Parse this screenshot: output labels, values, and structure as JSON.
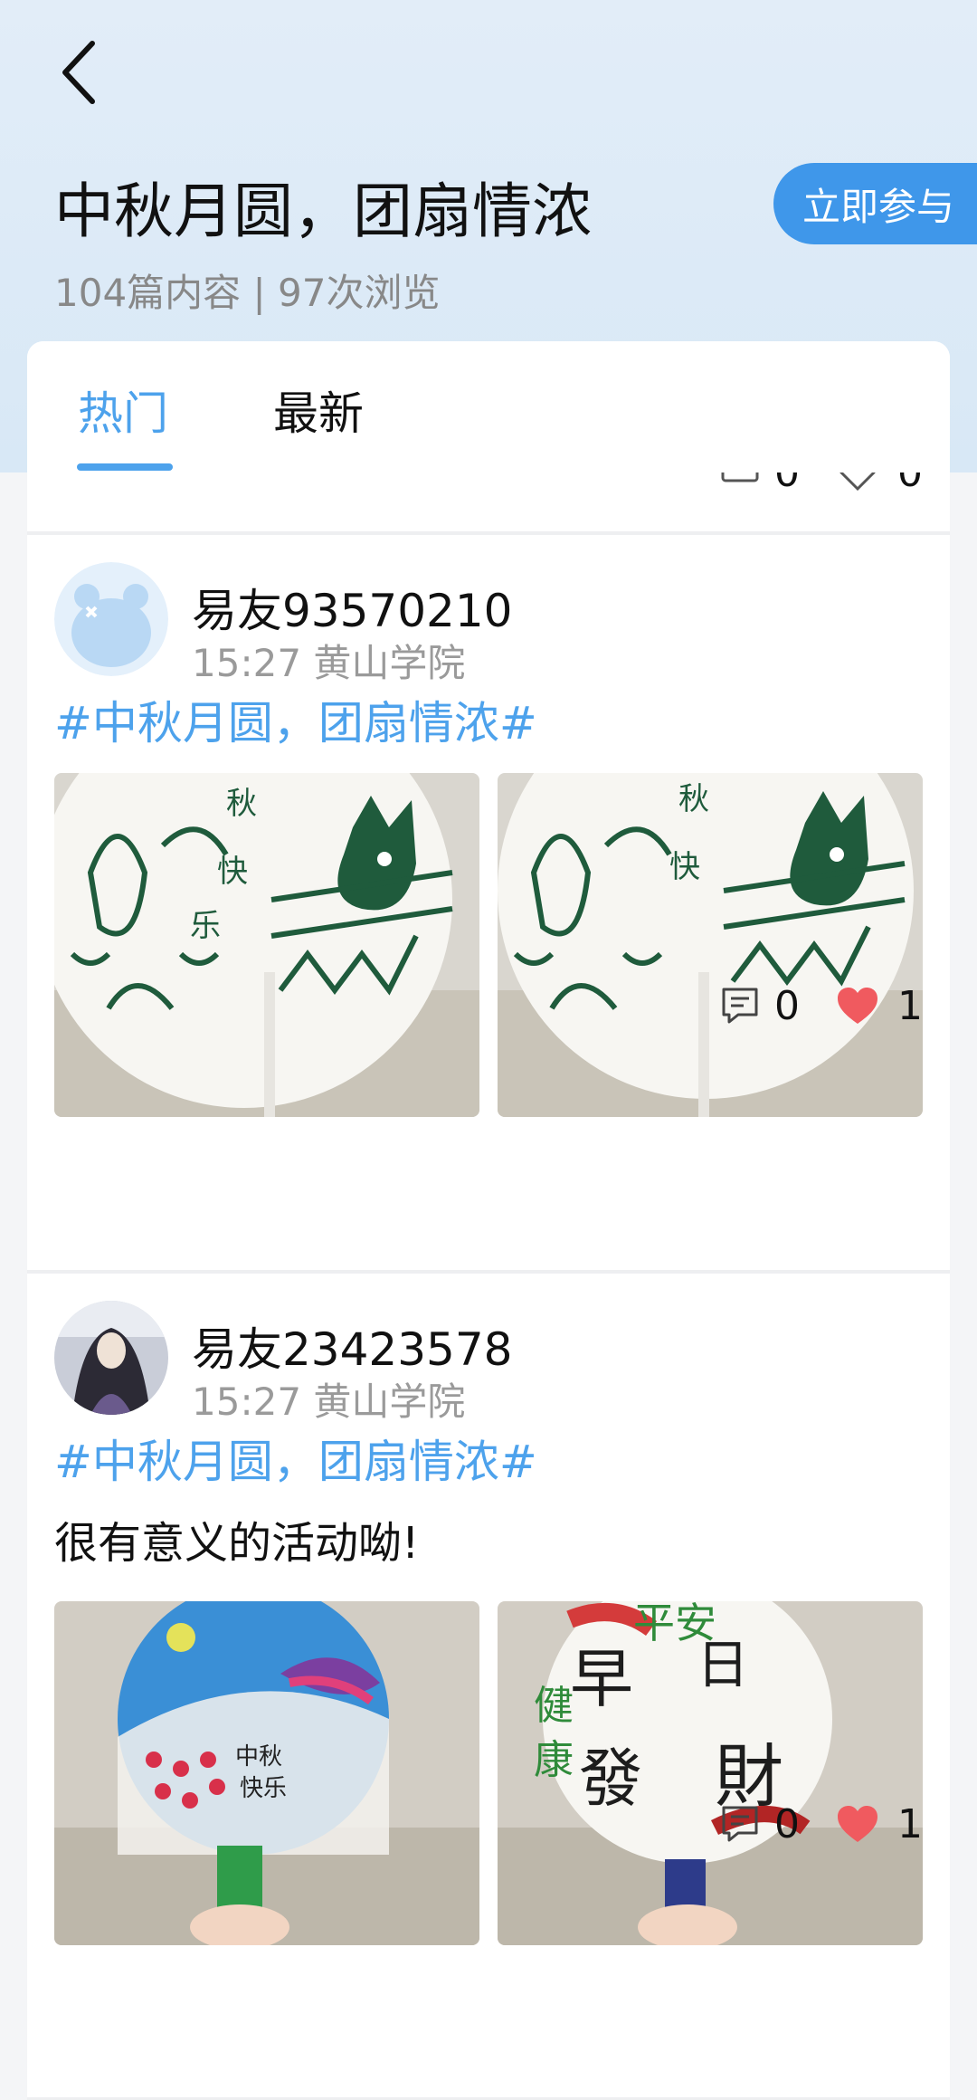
{
  "header": {
    "title": "中秋月圆，团扇情浓",
    "stats": "104篇内容 | 97次浏览",
    "join_label": "立即参与"
  },
  "tabs": [
    {
      "label": "热门",
      "active": true
    },
    {
      "label": "最新",
      "active": false
    }
  ],
  "previous_post": {
    "comment_count": "0",
    "like_count": "0"
  },
  "posts": [
    {
      "username": "易友93570210",
      "meta": "15:27 黄山学院",
      "topic": "#中秋月圆，团扇情浓#",
      "text": "",
      "images": [
        "fan-doodle-green-cat",
        "fan-doodle-green-cat"
      ],
      "comment_count": "0",
      "like_count": "1",
      "liked": true
    },
    {
      "username": "易友23423578",
      "meta": "15:27 黄山学院",
      "topic": "#中秋月圆，团扇情浓#",
      "text": "很有意义的活动呦!",
      "images": [
        "fan-painted-mid-autumn",
        "fan-calligraphy-blessings"
      ],
      "comment_count": "0",
      "like_count": "1",
      "liked": true
    }
  ],
  "colors": {
    "accent": "#4da2ec",
    "join_button": "#3f97ea",
    "like_red": "#f05a5f",
    "muted_text": "#9a9a9a"
  }
}
